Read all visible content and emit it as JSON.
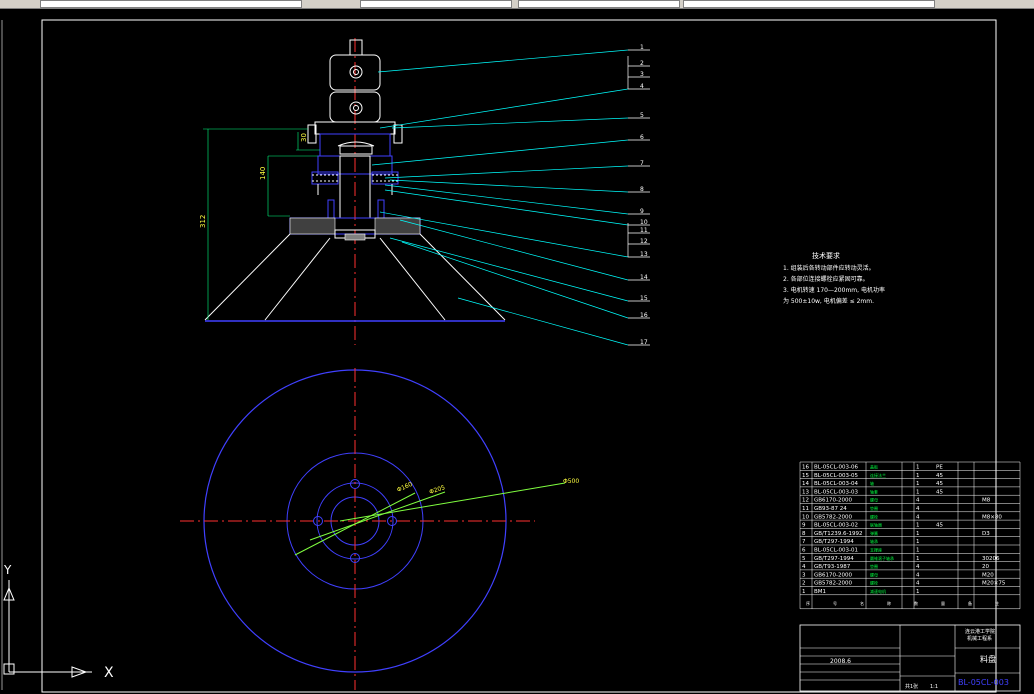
{
  "toolbar": {
    "items": [
      "",
      "",
      "",
      ""
    ]
  },
  "balloons": [
    "1",
    "2",
    "3",
    "4",
    "5",
    "6",
    "7",
    "8",
    "9",
    "10",
    "11",
    "12",
    "13",
    "14",
    "15",
    "16",
    "17"
  ],
  "dims": {
    "d30": "30",
    "d140": "140",
    "d312": "312",
    "dia_a": "Φ160",
    "dia_b": "Φ205",
    "dia_c": "Φ500"
  },
  "notes": {
    "title": "技术要求",
    "lines": [
      "1. 组装后各转动部件应转动灵活。",
      "2. 各部位连接螺栓应紧固可靠。",
      "3. 电机转速 170—200mm, 电机功率",
      "为 500±10w, 电机偏差 ≤ 2mm."
    ]
  },
  "bom": {
    "rows": [
      [
        "16",
        "BL-05CL-003-06",
        "盖板",
        "1",
        "PE",
        ""
      ],
      [
        "15",
        "BL-05CL-003-05",
        "连接法兰",
        "1",
        "45",
        ""
      ],
      [
        "14",
        "BL-05CL-003-04",
        "轴",
        "1",
        "45",
        ""
      ],
      [
        "13",
        "BL-05CL-003-03",
        "轴套",
        "1",
        "45",
        ""
      ],
      [
        "12",
        "GB6170-2000",
        "螺母",
        "4",
        "",
        "M8"
      ],
      [
        "11",
        "GB93-87 24",
        "垫圈",
        "4",
        "",
        ""
      ],
      [
        "10",
        "GB5782-2000",
        "螺栓",
        "4",
        "",
        "M8×80"
      ],
      [
        "9",
        "BL-05CL-003-02",
        "联轴器",
        "1",
        "45",
        ""
      ],
      [
        "8",
        "GB/T1239.6-1992",
        "弹簧",
        "1",
        "",
        "D3"
      ],
      [
        "7",
        "GB/T297-1994",
        "轴承",
        "1",
        "",
        ""
      ],
      [
        "6",
        "BL-05CL-003-01",
        "支撑座",
        "1",
        "",
        ""
      ],
      [
        "5",
        "GB/T297-1994",
        "圆锥滚子轴承",
        "1",
        "",
        "30206"
      ],
      [
        "4",
        "GB/T93-1987",
        "垫圈",
        "4",
        "",
        "20"
      ],
      [
        "3",
        "GB6170-2000",
        "螺母",
        "4",
        "",
        "M20"
      ],
      [
        "2",
        "GB5782-2000",
        "螺栓",
        "4",
        "",
        "M20×75"
      ],
      [
        "1",
        "BM1",
        "减速电机",
        "1",
        "",
        ""
      ]
    ],
    "header_small": [
      "序",
      "号",
      "名",
      "称",
      "数",
      "量",
      "备",
      "注"
    ],
    "company": "连云港工学院",
    "company2": "机械工程系",
    "title_block_name": "料盘",
    "ratio": "1:1",
    "sheet": "共1张",
    "drawing_no": "BL-05CL-003",
    "date": "2008.6"
  },
  "ucs": {
    "x_label": "X",
    "y_label": "Y"
  }
}
